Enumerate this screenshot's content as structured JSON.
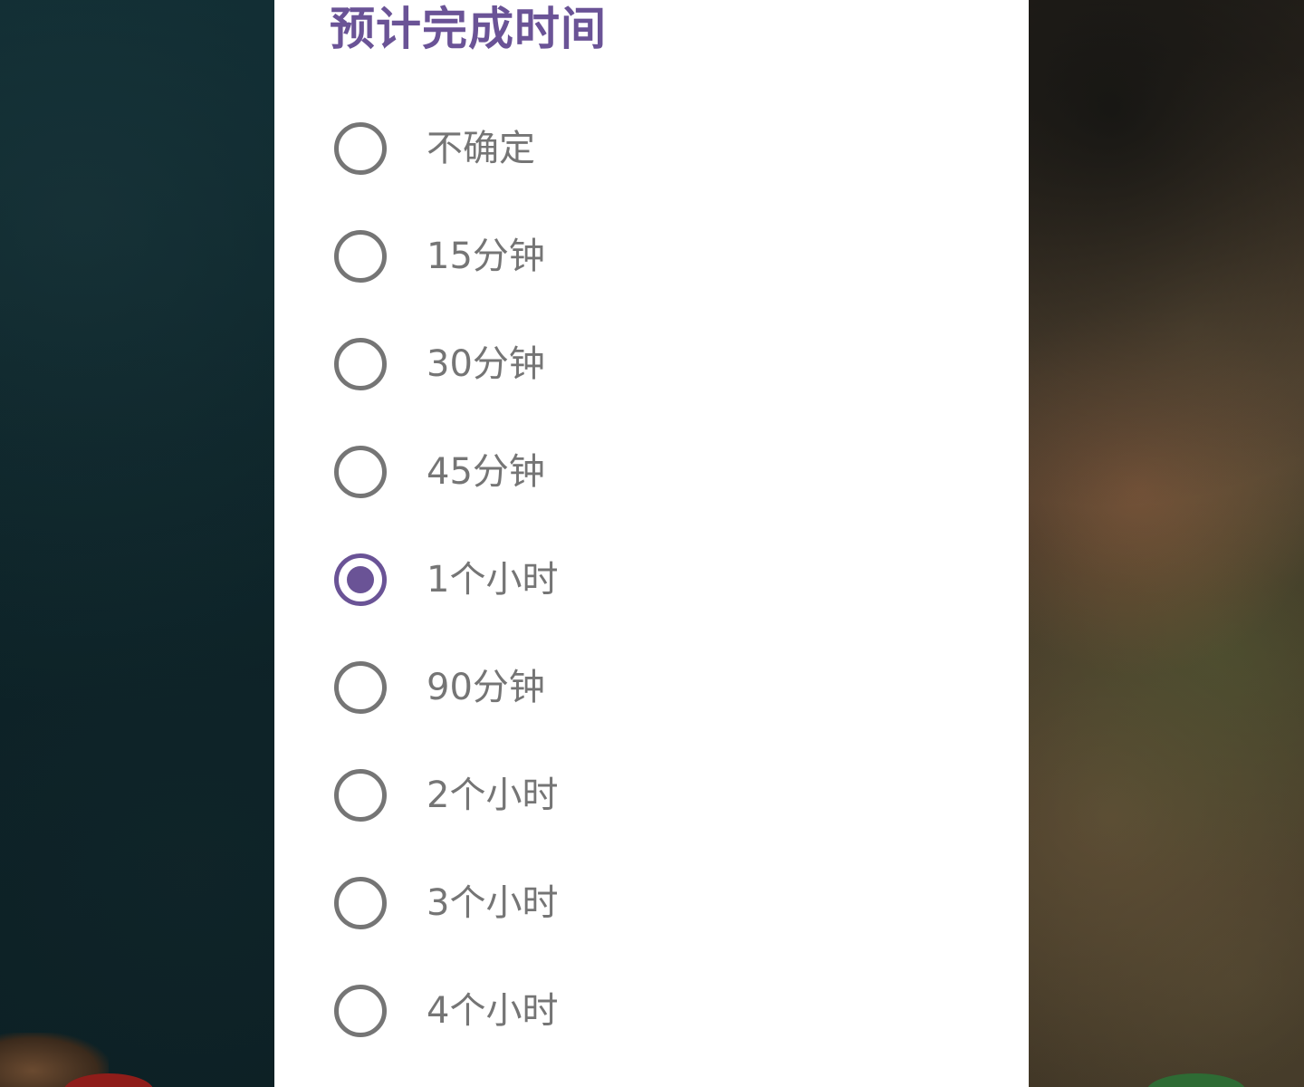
{
  "colors": {
    "accent": "#6a5396",
    "text_secondary": "#757575",
    "dialog_background": "#ffffff"
  },
  "dialog": {
    "title": "预计完成时间",
    "selected_index": 4,
    "options": [
      {
        "label": "不确定"
      },
      {
        "label": "15分钟"
      },
      {
        "label": "30分钟"
      },
      {
        "label": "45分钟"
      },
      {
        "label": "1个小时"
      },
      {
        "label": "90分钟"
      },
      {
        "label": "2个小时"
      },
      {
        "label": "3个小时"
      },
      {
        "label": "4个小时"
      }
    ]
  }
}
